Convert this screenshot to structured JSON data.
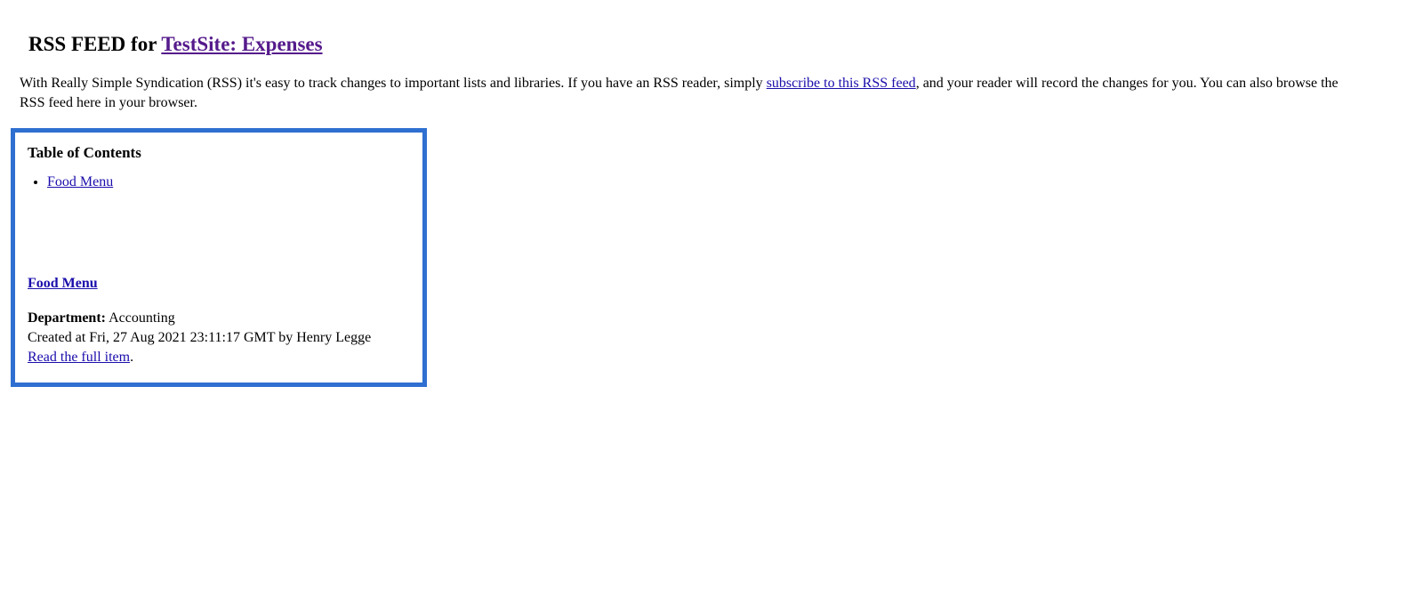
{
  "heading": {
    "prefix": "RSS FEED for ",
    "link_text": "TestSite: Expenses"
  },
  "intro": {
    "part1": "With Really Simple Syndication (RSS) it's easy to track changes to important lists and libraries. If you have an RSS reader, simply ",
    "link_text": "subscribe to this RSS feed",
    "part2": ", and your reader will record the changes for you. You can also browse the RSS feed here in your browser."
  },
  "toc": {
    "title": "Table of Contents",
    "items": [
      "Food Menu"
    ]
  },
  "item": {
    "title": "Food Menu",
    "department_label": "Department:",
    "department_value": " Accounting",
    "created_line": "Created at Fri, 27 Aug 2021 23:11:17 GMT by Henry Legge",
    "read_full_link": "Read the full item",
    "period": "."
  }
}
